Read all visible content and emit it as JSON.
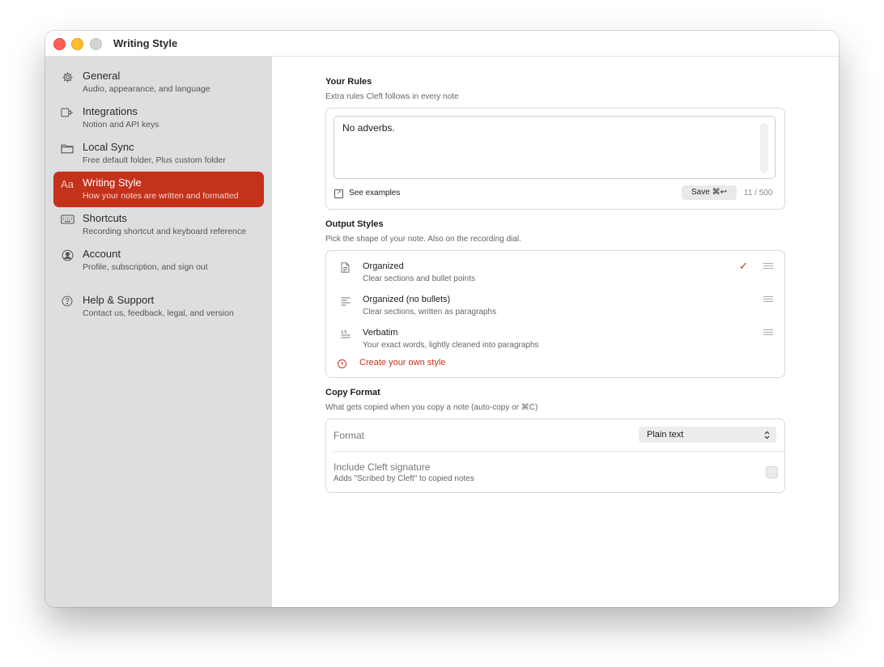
{
  "window": {
    "title": "Writing Style"
  },
  "sidebar": {
    "items": [
      {
        "title": "General",
        "subtitle": "Audio, appearance, and language",
        "icon": "gear-icon"
      },
      {
        "title": "Integrations",
        "subtitle": "Notion and API keys",
        "icon": "plug-icon"
      },
      {
        "title": "Local Sync",
        "subtitle": "Free default folder, Plus custom folder",
        "icon": "folder-icon"
      },
      {
        "title": "Writing Style",
        "subtitle": "How your notes are written and formatted",
        "icon": "text-style-icon",
        "icon_glyph": "Aa",
        "active": true
      },
      {
        "title": "Shortcuts",
        "subtitle": "Recording shortcut and keyboard reference",
        "icon": "keyboard-icon"
      },
      {
        "title": "Account",
        "subtitle": "Profile, subscription, and sign out",
        "icon": "person-circle-icon"
      },
      {
        "title": "Help & Support",
        "subtitle": "Contact us, feedback, legal, and version",
        "icon": "help-icon"
      }
    ]
  },
  "rules": {
    "title": "Your Rules",
    "subtitle": "Extra rules Cleft follows in every note",
    "text": "No adverbs.",
    "see_examples": "See examples",
    "save_label": "Save ⌘↩",
    "counter": "11 / 500"
  },
  "output_styles": {
    "title": "Output Styles",
    "subtitle": "Pick the shape of your note. Also on the recording dial.",
    "items": [
      {
        "name": "Organized",
        "desc": "Clear sections and bullet points",
        "icon": "document-icon",
        "selected": true
      },
      {
        "name": "Organized (no bullets)",
        "desc": "Clear sections, written as paragraphs",
        "icon": "paragraph-icon",
        "selected": false
      },
      {
        "name": "Verbatim",
        "desc": "Your exact words, lightly cleaned into paragraphs",
        "icon": "verbatim-icon",
        "selected": false
      }
    ],
    "check_glyph": "✓",
    "create_label": "Create your own style",
    "create_glyph": "+"
  },
  "copy_format": {
    "title": "Copy Format",
    "subtitle": "What gets copied when you copy a note (auto-copy or ⌘C)",
    "format_label": "Format",
    "format_value": "Plain text",
    "chevron_glyph": "⌃⌄",
    "signature_label": "Include Cleft signature",
    "signature_sub": "Adds \"Scribed by Cleft\" to copied notes",
    "signature_checked": false
  },
  "colors": {
    "accent": "#c4321b",
    "sidebar_bg": "#dcdedf"
  }
}
